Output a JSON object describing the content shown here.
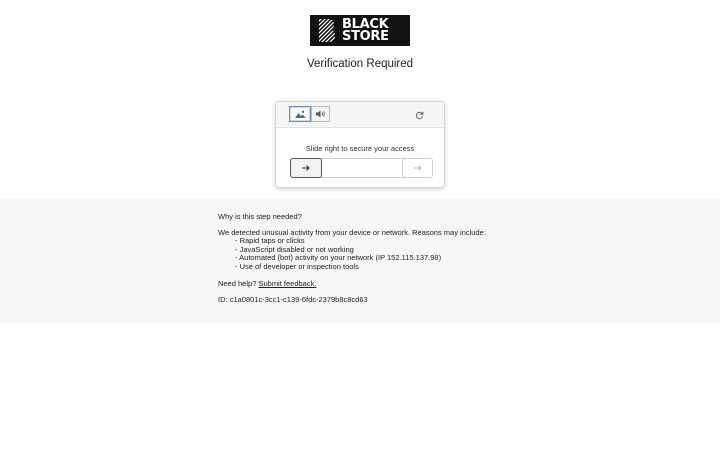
{
  "logo": {
    "line1": "BLACK",
    "line2": "STORE"
  },
  "page": {
    "title": "Verification Required"
  },
  "captcha": {
    "modes": [
      {
        "name": "image",
        "icon": "image-icon",
        "active": true
      },
      {
        "name": "audio",
        "icon": "speaker-icon",
        "active": false
      }
    ],
    "refresh_icon": "refresh-icon",
    "prompt": "Slide right to secure your access",
    "handle_icon": "arrow-right-icon",
    "target_icon": "arrow-right-icon",
    "slider_progress": 0
  },
  "info": {
    "why": "Why is this step needed?",
    "intro": "We detected unusual activity from your device or network. Reasons may include:",
    "reasons": [
      "Rapid taps or clicks",
      "JavaScript disabled or not working",
      "Automated (bot) activity on your network (IP 152.115.137.98)",
      "Use of developer or inspection tools"
    ],
    "help_prefix": "Need help?",
    "help_link": "Submit feedback.",
    "id_label": "ID:",
    "id_value": "c1a0801c-3cc1-c139-6fdc-2379b8c8cd63"
  }
}
